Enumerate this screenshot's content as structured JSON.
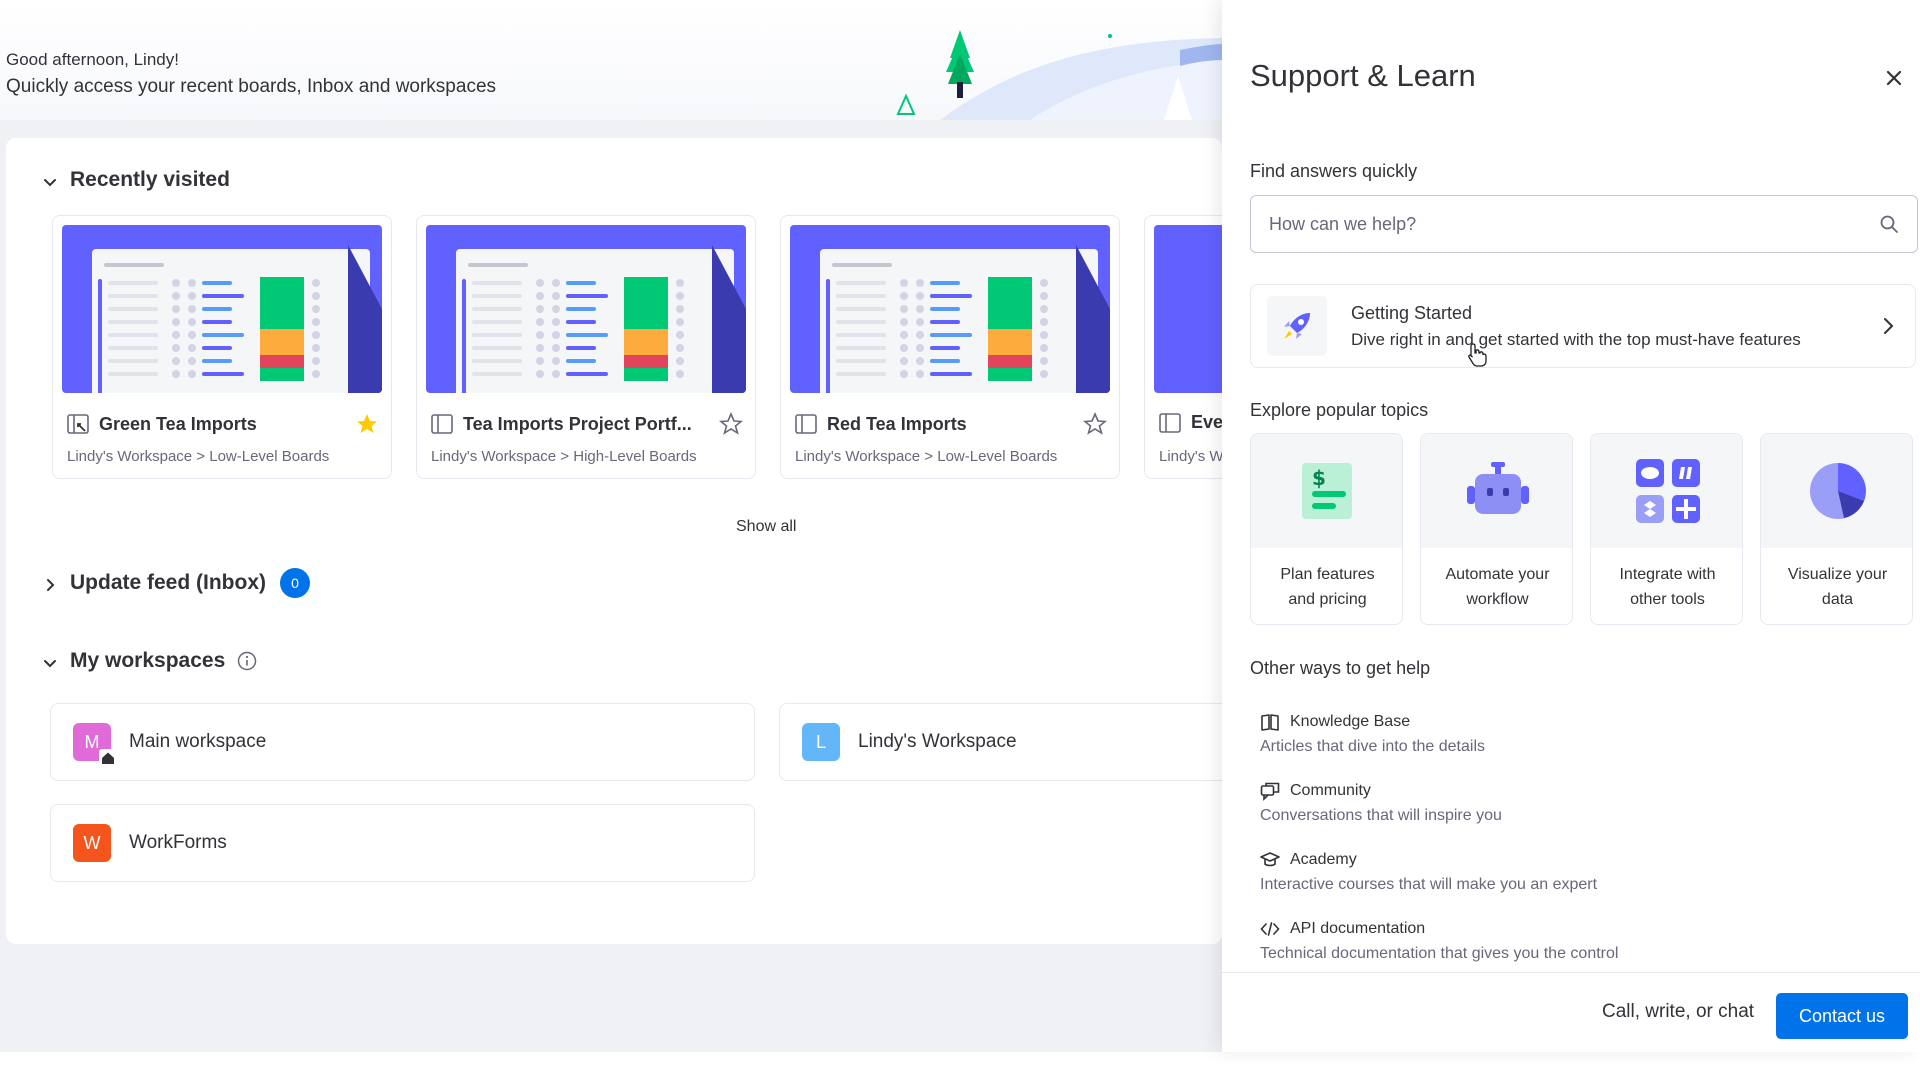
{
  "header": {
    "greeting": "Good afternoon, Lindy!",
    "subtitle": "Quickly access your recent boards, Inbox and workspaces"
  },
  "recently_visited": {
    "title": "Recently visited",
    "boards": [
      {
        "title": "Green Tea Imports",
        "path": "Lindy's Workspace > Low-Level Boards",
        "starred": true,
        "icon": "dashboard-board-icon"
      },
      {
        "title": "Tea Imports Project Portf...",
        "path": "Lindy's Workspace > High-Level Boards",
        "starred": false,
        "icon": "board-icon"
      },
      {
        "title": "Red Tea Imports",
        "path": "Lindy's Workspace > Low-Level Boards",
        "starred": false,
        "icon": "board-icon"
      },
      {
        "title": "Ever",
        "path": "Lindy's W",
        "starred": false,
        "icon": "board-icon"
      }
    ],
    "show_all": "Show all"
  },
  "update_feed": {
    "title": "Update feed (Inbox)",
    "count": "0"
  },
  "workspaces": {
    "title": "My workspaces",
    "items": [
      {
        "initial": "M",
        "name": "Main workspace",
        "color": "#e06bd8"
      },
      {
        "initial": "L",
        "name": "Lindy's Workspace",
        "color": "#63b6f7"
      },
      {
        "initial": "W",
        "name": "WorkForms",
        "color": "#f5541d"
      }
    ]
  },
  "panel": {
    "title": "Support & Learn",
    "find_label": "Find answers quickly",
    "search_placeholder": "How can we help?",
    "getting_started": {
      "title": "Getting Started",
      "description": "Dive right in and get started with the top must-have features"
    },
    "explore_label": "Explore popular topics",
    "topics": [
      {
        "line1": "Plan features",
        "line2": "and pricing",
        "icon": "pricing-icon"
      },
      {
        "line1": "Automate your",
        "line2": "workflow",
        "icon": "robot-icon"
      },
      {
        "line1": "Integrate with",
        "line2": "other tools",
        "icon": "integrations-icon"
      },
      {
        "line1": "Visualize your",
        "line2": "data",
        "icon": "pie-chart-icon"
      }
    ],
    "other_label": "Other ways to get help",
    "help_items": [
      {
        "title": "Knowledge Base",
        "description": "Articles that dive into the details",
        "icon": "book-icon"
      },
      {
        "title": "Community",
        "description": "Conversations that will inspire you",
        "icon": "community-icon"
      },
      {
        "title": "Academy",
        "description": "Interactive courses that will make you an expert",
        "icon": "graduation-cap-icon"
      },
      {
        "title": "API documentation",
        "description": "Technical documentation that gives you the control",
        "icon": "code-icon"
      }
    ],
    "footer_text": "Call, write, or chat",
    "contact_label": "Contact us"
  },
  "colors": {
    "accent": "#0073ea",
    "board_thumb": "#6161ff",
    "star_active": "#ffcb00"
  }
}
